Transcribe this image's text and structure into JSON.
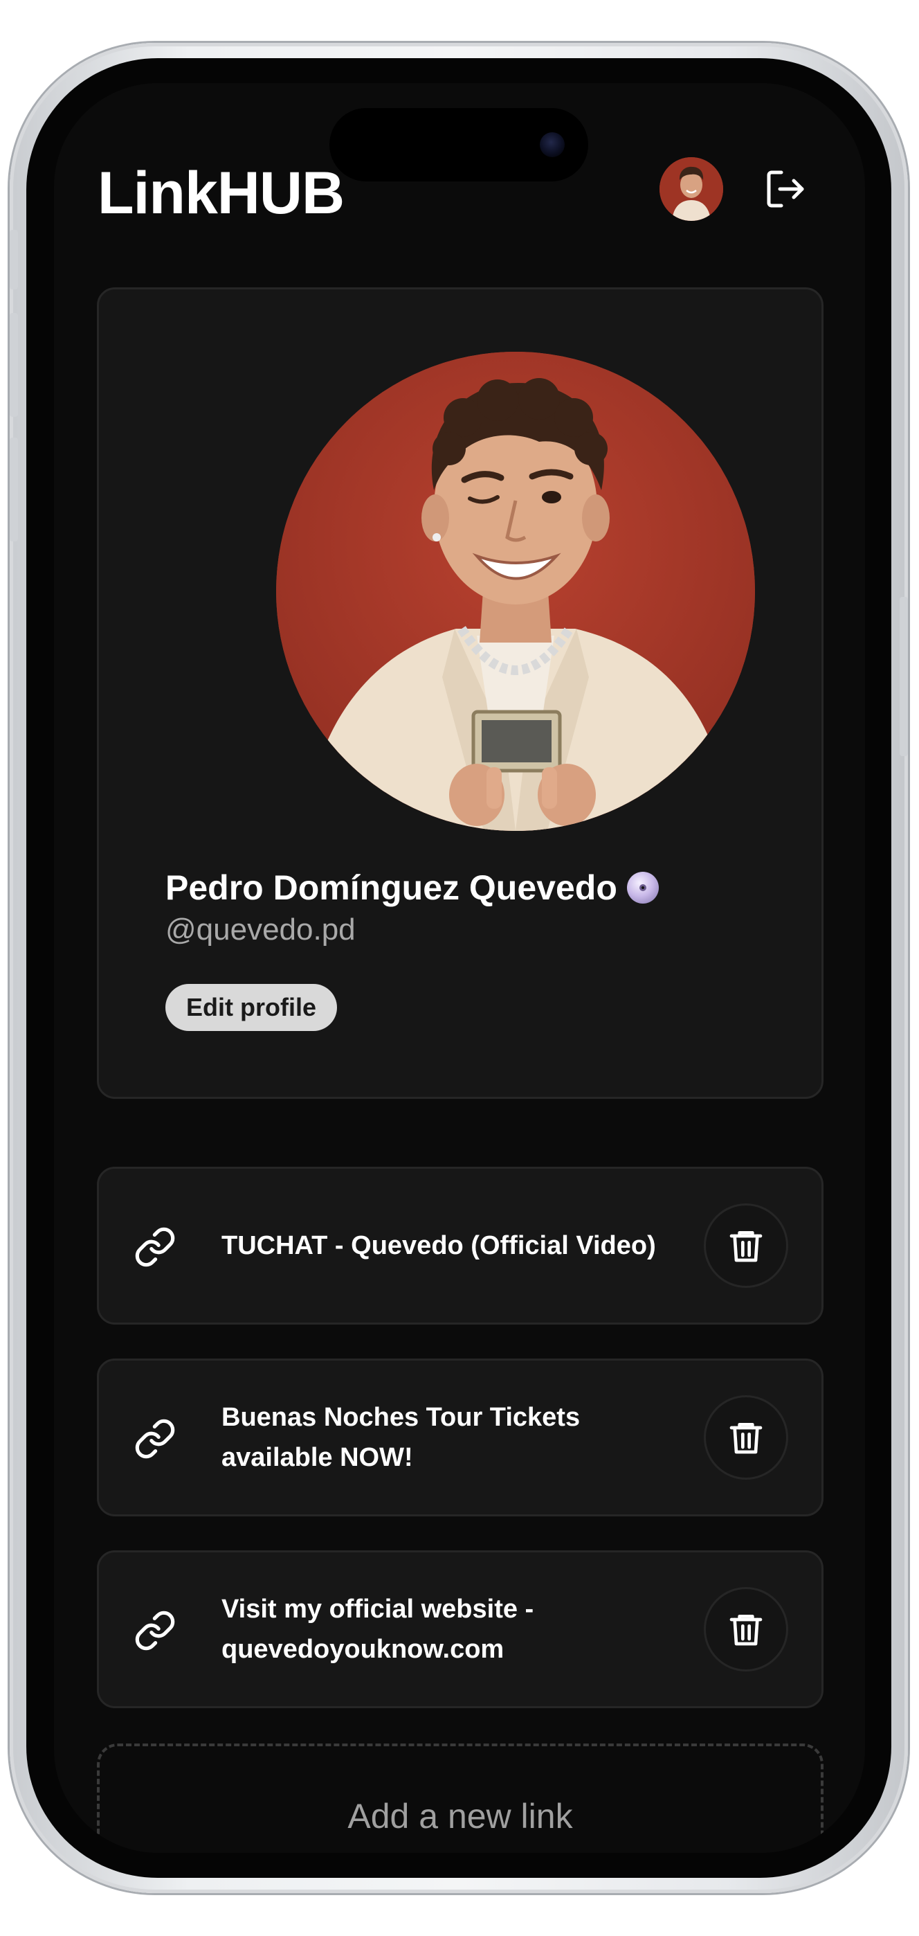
{
  "header": {
    "app_title": "LinkHUB",
    "avatar_icon": "user-avatar",
    "logout_icon": "logout-icon"
  },
  "profile": {
    "name": "Pedro Domínguez Quevedo",
    "handle": "@quevedo.pd",
    "verified_icon": "verified-disc-icon",
    "edit_label": "Edit profile"
  },
  "links": [
    {
      "title": "TUCHAT - Quevedo (Official Video)",
      "icon": "link-icon",
      "delete_icon": "trash-icon"
    },
    {
      "title": "Buenas Noches Tour Tickets available NOW!",
      "icon": "link-icon",
      "delete_icon": "trash-icon"
    },
    {
      "title": "Visit my official website - quevedoyouknow.com",
      "icon": "link-icon",
      "delete_icon": "trash-icon"
    }
  ],
  "add_link": {
    "label": "Add a new link"
  },
  "colors": {
    "background": "#0b0b0b",
    "card": "#161616",
    "card_border": "#262626",
    "text": "#ffffff",
    "muted_text": "#a9a9a9",
    "photo_backdrop": "#a8392a",
    "edit_button": "#d9d9d9"
  }
}
